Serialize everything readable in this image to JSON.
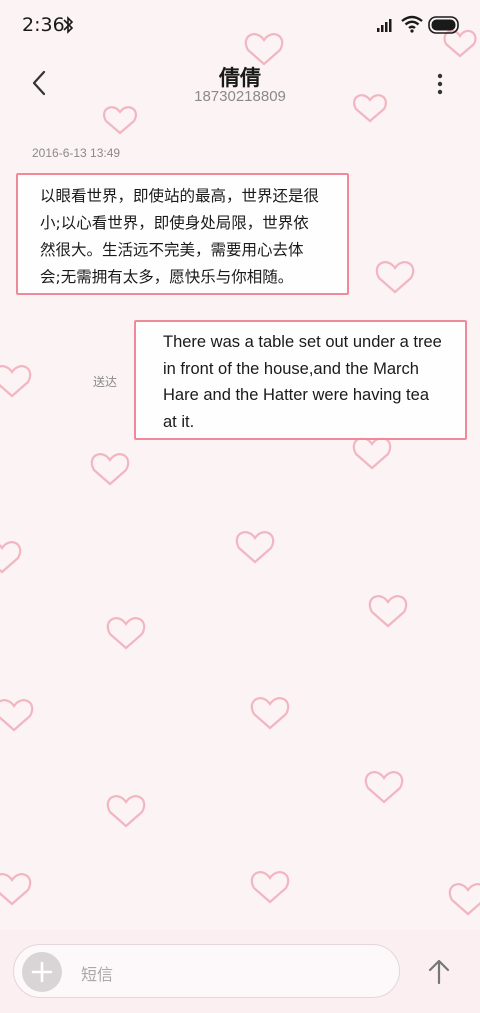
{
  "status_bar": {
    "time": "2:36",
    "icons": [
      "bluetooth-icon",
      "signal-icon",
      "wifi-icon",
      "battery-icon"
    ]
  },
  "header": {
    "contact_name": "倩倩",
    "contact_number": "18730218809",
    "back_icon": "chevron-left-icon",
    "more_icon": "more-vertical-icon"
  },
  "conversation": {
    "timestamp": "2016-6-13 13:49",
    "received_message": {
      "lines": [
        "以眼看世界，即使站的最高，世界还是很",
        "小;以心看世界，即使身处局限，世界依",
        "然很大。生活远不完美，需要用心去体",
        "会;无需拥有太多，愿快乐与你相随。"
      ]
    },
    "sent_message": {
      "status": "送达",
      "lines": [
        "There was a table set out under a tree",
        "in front of the house,and the March",
        "Hare and the Hatter were having tea",
        "at it."
      ]
    }
  },
  "composer": {
    "placeholder": "短信",
    "add_icon": "plus-icon",
    "send_icon": "arrow-up-icon"
  },
  "colors": {
    "background": "#fcf3f4",
    "bubble_border": "#f08a9b",
    "heart": "#f2b6c1",
    "muted_text": "#8a8a8a"
  }
}
